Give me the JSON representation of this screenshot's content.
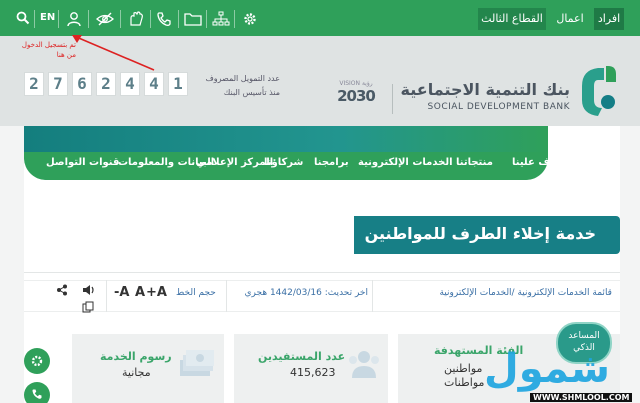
{
  "topbar": {
    "segments": [
      "افراد",
      "اعمال",
      "القطاع الثالث"
    ],
    "lang": "EN",
    "icons": [
      "search-icon",
      "user-icon",
      "eye-off-icon",
      "sign-language-icon",
      "phone-icon",
      "folder-icon",
      "sitemap-icon",
      "gear-icon"
    ],
    "colors": {
      "bar": "#2fa05a",
      "active": "#1f7a46"
    }
  },
  "annotation": {
    "line1": "تم بتسجيل الدخول",
    "line2": "من هنا"
  },
  "counter": {
    "digits": [
      "2",
      "7",
      "6",
      "2",
      "4",
      "4",
      "1"
    ],
    "label1": "عدد التمويل المصروف",
    "label2": "منذ تأسيس البنك"
  },
  "vision": {
    "text1": "VISION رؤية",
    "year": "2030"
  },
  "brand": {
    "arabic": "بنك التنمية الاجتماعية",
    "english": "SOCIAL DEVELOPMENT BANK"
  },
  "nav": {
    "items": [
      "تعرف علينا",
      "منتجاتنا",
      "الخدمات الإلكترونية",
      "برامجنا",
      "شركاؤنا",
      "المركز الإعلامي",
      "البيانات والمعلومات",
      "قنوات التواصل"
    ]
  },
  "page_title": "خدمة إخلاء الطرف للمواطنين",
  "infobar": {
    "breadcrumb": "قائمة الخدمات الإلكترونية /الخدمات الإلكترونية",
    "updated": "اخر تحديث: 1442/03/16 هجري",
    "font_size_label": "حجم الخط",
    "font_buttons": [
      "+A",
      "A",
      "-A"
    ]
  },
  "cards": [
    {
      "title": "الفئة المستهدفة",
      "value1": "مواطنين",
      "value2": "مواطنات"
    },
    {
      "title": "عدد المستفيدين",
      "value1": "415,623"
    },
    {
      "title": "رسوم الخدمة",
      "value1": "مجانية"
    }
  ],
  "assistant": {
    "line1": "المساعد",
    "line2": "الذكي"
  },
  "watermark": {
    "main": "شمول",
    "sub": "WWW.SHMLOOL.COM"
  }
}
